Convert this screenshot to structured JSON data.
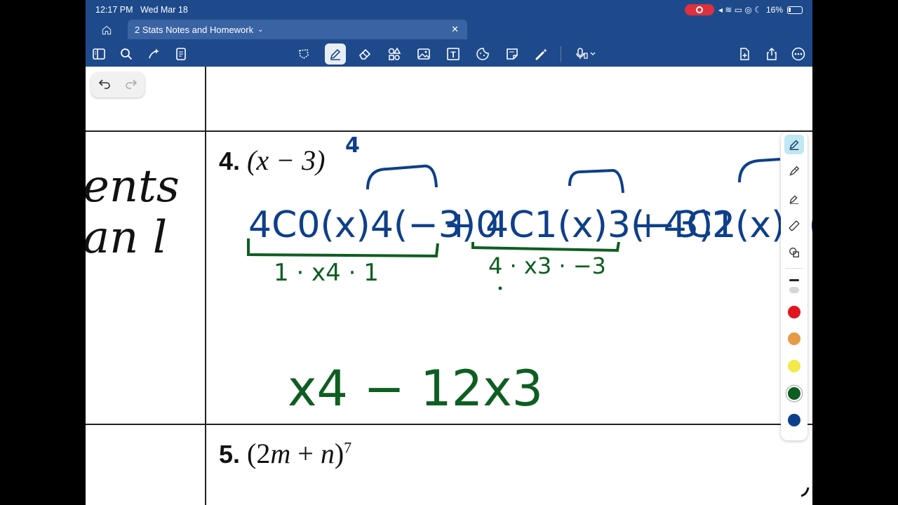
{
  "status": {
    "time": "12:17 PM",
    "date": "Wed Mar 18",
    "battery": "16%"
  },
  "tabs": {
    "document_title": "2 Stats Notes and Homework"
  },
  "toolbar": {
    "left_icons": [
      "sidebar-icon",
      "search-icon",
      "magic-icon",
      "page-icon"
    ],
    "center_icons": [
      "lasso-icon",
      "pen-icon",
      "eraser-icon",
      "shapes-icon",
      "image-icon",
      "text-icon",
      "sticker-icon",
      "sticky-note-icon",
      "laser-icon",
      "mic-icon"
    ],
    "right_icons": [
      "add-page-icon",
      "share-icon",
      "more-icon"
    ],
    "active_tool": "pen-icon"
  },
  "document": {
    "partial_left_text": [
      "ents",
      "an l"
    ],
    "problem4": {
      "number": "4.",
      "expression": "(x − 3)",
      "exponent_written": "4"
    },
    "problem5": {
      "number": "5.",
      "expression_open": "(2",
      "var1": "m",
      "plus": " + ",
      "var2": "n",
      "expression_close": ")",
      "exponent": "7"
    },
    "handwriting": {
      "blue_term1": "4C0(x)4(−3)0",
      "blue_term2": "+ 4C1(x)3(−3)1",
      "blue_term3": "+4C2(x)2(−3",
      "green_under1": "1 · x4 · 1",
      "green_under2": "4 · x3 · −3",
      "green_result": "x4 − 12x3"
    }
  },
  "palette": {
    "colors": [
      "#e3141c",
      "#e89a48",
      "#f3e948",
      "#0e5e22",
      "#0e3f8a"
    ],
    "selected_color": "#0e5e22"
  }
}
